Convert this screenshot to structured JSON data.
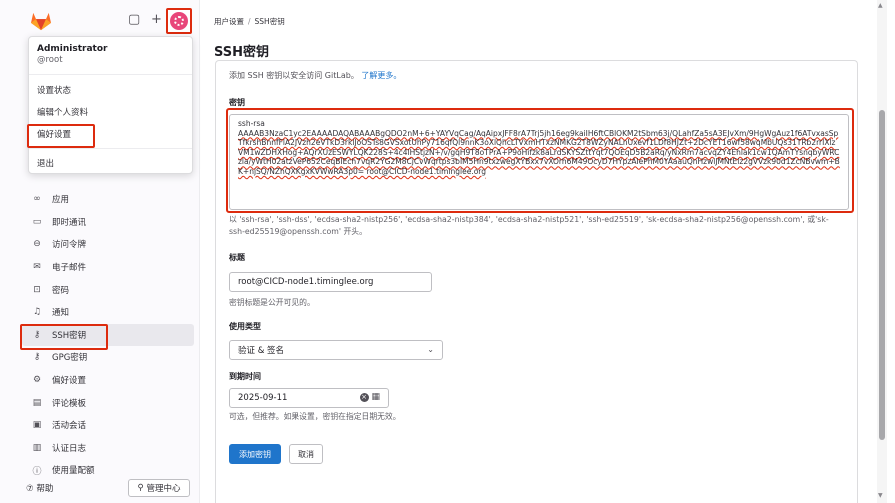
{
  "topbar": {
    "new_icon": "+",
    "sidebar_toggle_icon": "▢"
  },
  "dropdown": {
    "name": "Administrator",
    "handle": "@root",
    "items": [
      "设置状态",
      "编辑个人资料",
      "偏好设置",
      "退出"
    ]
  },
  "sidebar": {
    "items": [
      {
        "icon": "apps-icon",
        "glyph": "∞",
        "label": "应用"
      },
      {
        "icon": "comment-icon",
        "glyph": "▭",
        "label": "即时通讯"
      },
      {
        "icon": "token-icon",
        "glyph": "⊖",
        "label": "访问令牌"
      },
      {
        "icon": "mail-icon",
        "glyph": "✉",
        "label": "电子邮件"
      },
      {
        "icon": "lock-icon",
        "glyph": "⊡",
        "label": "密码"
      },
      {
        "icon": "bell-icon",
        "glyph": "♫",
        "label": "通知"
      },
      {
        "icon": "key-icon",
        "glyph": "⚷",
        "label": "SSH密钥"
      },
      {
        "icon": "key-icon",
        "glyph": "⚷",
        "label": "GPG密钥"
      },
      {
        "icon": "preferences-icon",
        "glyph": "⚙",
        "label": "偏好设置"
      },
      {
        "icon": "comment-template-icon",
        "glyph": "▤",
        "label": "评论模板"
      },
      {
        "icon": "sessions-icon",
        "glyph": "▣",
        "label": "活动会话"
      },
      {
        "icon": "log-icon",
        "glyph": "▥",
        "label": "认证日志"
      },
      {
        "icon": "quota-icon",
        "glyph": "ⓘ",
        "label": "使用量配额"
      }
    ],
    "help": "帮助",
    "admin": "管理中心"
  },
  "breadcrumb": {
    "parent": "用户设置",
    "current": "SSH密钥"
  },
  "page": {
    "title": "SSH密钥",
    "intro": "添加 SSH 密钥以安全访问 GitLab。",
    "learn_more": "了解更多。",
    "key_label": "密钥",
    "key_prefix": "ssh-rsa",
    "key_body": "AAAAB3NzaC1yc2EAAAADAQABAAABgQDO2nM+6+YAYVqCag/AqAipxJFF8rA7Trj5jh16eg9kaiIH6ftCBlOKM2tSbm63j/QLahfZa5sA3EJvXm/9HgWgAuz1f6ATvxasSpTfkrshBnnfFlA2JVzh2eVTkD3rklJoOSTs8GVSxotUhPy716qfQl9nnK3oXlQhcLTVxmHTxzNMKG2T8WZyNALnUxevf1LDf8HJZt+2DcYET16wf58wqMbUQs31TRb2rrIXlzVM1wZDHXHog+AQrXUzESWYLQK228S+4c4lHStjzN+/v/gqH9T8oTPrA+P9oHifzk8aLrdSKYSZttYqt7QOEqD5B2aRq/yNxRm7acvqZY4Ehlak1cw1QAmTYsnqbyWRCzla/yWtH02atzVeP652CeqBIEch7vqR2YG2M8CjCvWqrtps3bIM5Hn9txzwegXYBxx7vXOrh6M49OcyD7HYpzAIePhM0YAaauQnHzwlJMNtElz2gVVzk90d1ZcNBvwm+BK+njSQ/NZhQXKgxKVWwRA3p0= root@CICD-node1.timinglee.org",
    "key_help": "以 'ssh-rsa', 'ssh-dss', 'ecdsa-sha2-nistp256', 'ecdsa-sha2-nistp384', 'ecdsa-sha2-nistp521', 'ssh-ed25519', 'sk-ecdsa-sha2-nistp256@openssh.com', 或'sk-ssh-ed25519@openssh.com' 开头。",
    "title_label": "标题",
    "title_value": "root@CICD-node1.timinglee.org",
    "title_help": "密钥标题是公开可见的。",
    "usage_label": "使用类型",
    "usage_value": "验证 & 签名",
    "expiry_label": "到期时间",
    "expiry_value": "2025-09-11",
    "expiry_help": "可选，但推荐。如果设置，密钥在指定日期无效。",
    "submit": "添加密钥",
    "cancel": "取消"
  },
  "colors": {
    "accent": "#dd2b0e",
    "primary": "#1f75cb"
  }
}
